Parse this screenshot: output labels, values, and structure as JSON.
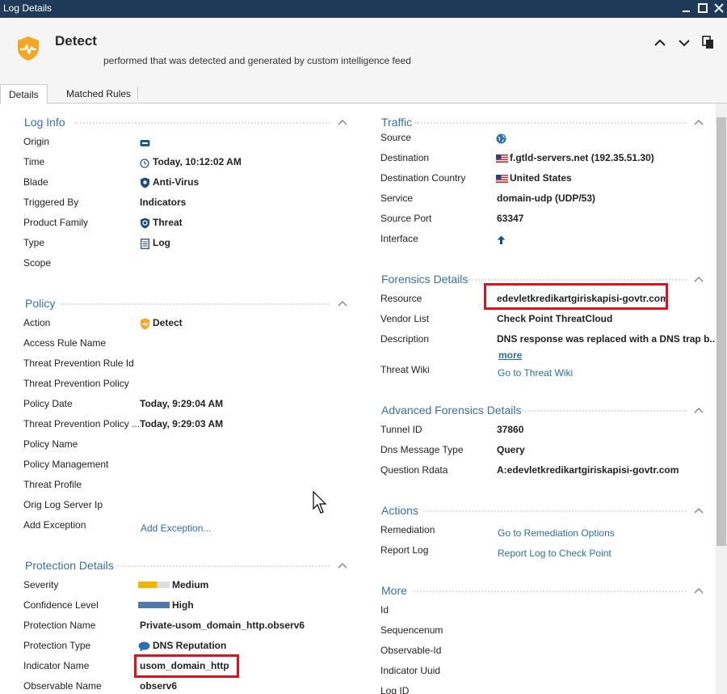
{
  "window": {
    "title": "Log Details"
  },
  "header": {
    "title": "Detect",
    "subtitle": "performed  that was detected and generated by custom intelligence feed"
  },
  "tabs": [
    {
      "label": "Details",
      "active": true
    },
    {
      "label": "Matched Rules",
      "active": false
    }
  ],
  "log_info": {
    "title": "Log Info",
    "labels": {
      "origin": "Origin",
      "time": "Time",
      "blade": "Blade",
      "triggered_by": "Triggered By",
      "product_family": "Product Family",
      "type": "Type",
      "scope": "Scope"
    },
    "values": {
      "origin": "",
      "time": "Today, 10:12:02 AM",
      "blade": "Anti-Virus",
      "triggered_by": "Indicators",
      "product_family": "Threat",
      "type": "Log",
      "scope": ""
    }
  },
  "policy": {
    "title": "Policy",
    "labels": {
      "action": "Action",
      "access_rule_name": "Access Rule Name",
      "tp_rule_id": "Threat Prevention Rule Id",
      "tp_policy": "Threat Prevention Policy",
      "policy_date": "Policy Date",
      "tp_policy_trunc": "Threat Prevention Policy ...",
      "policy_name": "Policy Name",
      "policy_management": "Policy Management",
      "threat_profile": "Threat Profile",
      "orig_log_server_ip": "Orig Log Server Ip",
      "add_exception": "Add Exception"
    },
    "values": {
      "action": "Detect",
      "policy_date": "Today, 9:29:04 AM",
      "tp_policy_trunc": "Today, 9:29:03 AM",
      "add_exception_link": "Add Exception..."
    }
  },
  "protection_details": {
    "title": "Protection Details",
    "labels": {
      "severity": "Severity",
      "confidence_level": "Confidence Level",
      "protection_name": "Protection Name",
      "protection_type": "Protection Type",
      "indicator_name": "Indicator Name",
      "observable_name": "Observable Name"
    },
    "values": {
      "severity": "Medium",
      "confidence_level": "High",
      "protection_name": "Private-usom_domain_http.observ6",
      "protection_type": "DNS Reputation",
      "indicator_name": "usom_domain_http",
      "observable_name": "observ6"
    },
    "severity_level": 0.6,
    "confidence_level_fill": 1.0
  },
  "traffic": {
    "title": "Traffic",
    "labels": {
      "source": "Source",
      "destination": "Destination",
      "destination_country": "Destination Country",
      "service": "Service",
      "source_port": "Source Port",
      "interface": "Interface"
    },
    "values": {
      "destination": "f.gtld-servers.net (192.35.51.30)",
      "destination_country": "United States",
      "service": "domain-udp (UDP/53)",
      "source_port": "63347"
    }
  },
  "forensics": {
    "title": "Forensics Details",
    "labels": {
      "resource": "Resource",
      "vendor_list": "Vendor List",
      "description": "Description",
      "threat_wiki": "Threat Wiki"
    },
    "values": {
      "resource": "edevletkredikartgiriskapisi-govtr.com",
      "vendor_list": "Check Point ThreatCloud",
      "description": "DNS response was replaced with a DNS trap b...",
      "more_link": "more",
      "threat_wiki_link": "Go to Threat Wiki"
    }
  },
  "advanced_forensics": {
    "title": "Advanced Forensics Details",
    "labels": {
      "tunnel_id": "Tunnel ID",
      "dns_message_type": "Dns Message Type",
      "question_rdata": "Question Rdata"
    },
    "values": {
      "tunnel_id": "37860",
      "dns_message_type": "Query",
      "question_rdata": "A:edevletkredikartgiriskapisi-govtr.com"
    }
  },
  "actions": {
    "title": "Actions",
    "labels": {
      "remediation": "Remediation",
      "report_log": "Report Log"
    },
    "values": {
      "remediation_link": "Go to Remediation Options",
      "report_log_link": "Report Log to Check Point"
    }
  },
  "more": {
    "title": "More",
    "labels": {
      "id": "Id",
      "sequencenum": "Sequencenum",
      "observable_id": "Observable-Id",
      "indicator_uuid": "Indicator Uuid",
      "log_id": "Log ID"
    }
  },
  "colors": {
    "title_bar": "#1f3a58",
    "section_title": "#3a6ea8",
    "link": "#2f6ca8",
    "highlight_box": "#e0101c",
    "severity_bar": "#f5b400",
    "confidence_bar": "#4f79aa",
    "detect_icon": "#f5a623"
  }
}
